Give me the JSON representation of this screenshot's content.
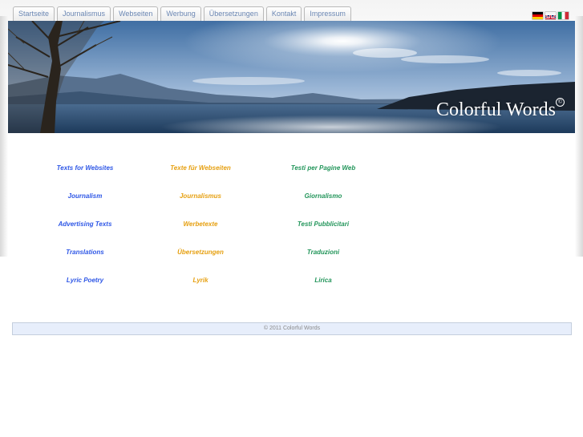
{
  "nav": {
    "tabs": [
      {
        "label": "Startseite"
      },
      {
        "label": "Journalismus"
      },
      {
        "label": "Webseiten"
      },
      {
        "label": "Werbung"
      },
      {
        "label": "Übersetzungen"
      },
      {
        "label": "Kontakt"
      },
      {
        "label": "Impressum"
      }
    ]
  },
  "languages": [
    {
      "name": "german-flag-icon"
    },
    {
      "name": "english-flag-icon"
    },
    {
      "name": "italian-flag-icon"
    }
  ],
  "banner": {
    "brand": "Colorful Words",
    "brand_mark": "©"
  },
  "colors": {
    "english": "#2d56e6",
    "german": "#e6a011",
    "italian": "#22955a",
    "tab_text": "#6b87b3",
    "footer_bg": "#e7eefb"
  },
  "services": {
    "english": [
      "Texts for Websites",
      "Journalism",
      "Advertising Texts",
      "Translations",
      "Lyric Poetry"
    ],
    "german": [
      "Texte für Webseiten",
      "Journalismus",
      "Werbetexte",
      "Übersetzungen",
      "Lyrik"
    ],
    "italian": [
      "Testi per Pagine Web",
      "Giornalismo",
      "Testi Pubblicitari",
      "Traduzioni",
      "Lirica"
    ]
  },
  "footer": {
    "text": "© 2011 Colorful Words"
  }
}
